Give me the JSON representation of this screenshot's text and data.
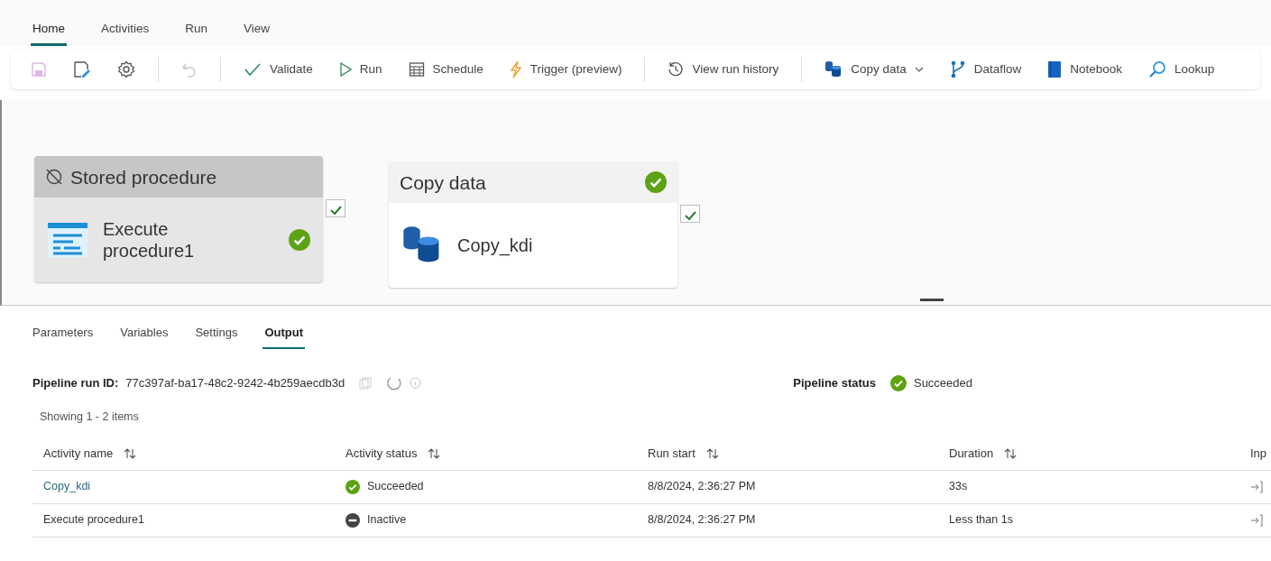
{
  "tabs": [
    {
      "label": "Home",
      "selected": true
    },
    {
      "label": "Activities",
      "selected": false
    },
    {
      "label": "Run",
      "selected": false
    },
    {
      "label": "View",
      "selected": false
    }
  ],
  "toolbar": [
    {
      "kind": "icon",
      "disabled": true
    },
    {
      "kind": "icon",
      "disabled": false
    },
    {
      "kind": "icon",
      "disabled": false
    },
    {
      "kind": "separator"
    },
    {
      "kind": "icon",
      "disabled": true
    },
    {
      "kind": "separator"
    },
    {
      "kind": "button",
      "label": "Validate",
      "disabled": false
    },
    {
      "kind": "button",
      "label": "Run",
      "disabled": false
    },
    {
      "kind": "button",
      "label": "Schedule",
      "disabled": false
    },
    {
      "kind": "button",
      "label": "Trigger (preview)",
      "disabled": false
    },
    {
      "kind": "separator"
    },
    {
      "kind": "button",
      "label": "View run history",
      "disabled": false
    },
    {
      "kind": "separator"
    },
    {
      "kind": "dropdown",
      "label": "Copy data",
      "disabled": false
    },
    {
      "kind": "button",
      "label": "Dataflow",
      "disabled": false
    },
    {
      "kind": "button",
      "label": "Notebook",
      "disabled": false
    },
    {
      "kind": "button",
      "label": "Lookup",
      "disabled": false
    }
  ],
  "canvas": {
    "nodes": [
      {
        "type": "Stored procedure",
        "name": "Execute procedure1",
        "deactivated": true,
        "succeeded": true
      },
      {
        "type": "Copy data",
        "name": "Copy_kdi",
        "deactivated": false,
        "succeeded": true
      }
    ]
  },
  "panel_tabs": [
    {
      "label": "Parameters",
      "selected": false
    },
    {
      "label": "Variables",
      "selected": false
    },
    {
      "label": "Settings",
      "selected": false
    },
    {
      "label": "Output",
      "selected": true
    }
  ],
  "run_info": {
    "run_id_label": "Pipeline run ID:",
    "run_id": "77c397af-ba17-48c2-9242-4b259aecdb3d",
    "status_label": "Pipeline status",
    "status": "Succeeded",
    "succeeded": true
  },
  "showing": "Showing 1 - 2 items",
  "table": {
    "columns": [
      {
        "label": "Activity name",
        "sortable": true
      },
      {
        "label": "Activity status",
        "sortable": true
      },
      {
        "label": "Run start",
        "sortable": true
      },
      {
        "label": "Duration",
        "sortable": true
      },
      {
        "label": "Inp",
        "sortable": false
      }
    ],
    "rows": [
      {
        "activity_name": "Copy_kdi",
        "link": true,
        "status": "Succeeded",
        "kind": "succeeded",
        "run_start": "8/8/2024, 2:36:27 PM",
        "duration": "33s"
      },
      {
        "activity_name": "Execute procedure1",
        "link": false,
        "status": "Inactive",
        "kind": "inactive",
        "run_start": "8/8/2024, 2:36:27 PM",
        "duration": "Less than 1s"
      }
    ]
  }
}
